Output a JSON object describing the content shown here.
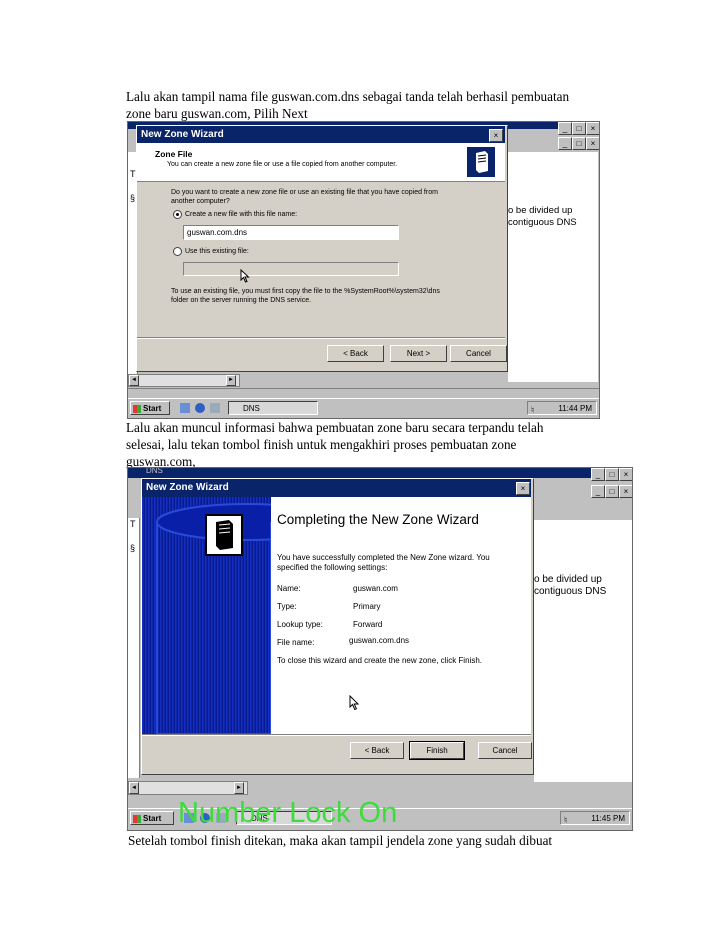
{
  "doc": {
    "p1_line1": "Lalu akan tampil nama file guswan.com.dns sebagai tanda telah berhasil pembuatan",
    "p1_line2": "zone baru guswan.com, Pilih Next",
    "p2_line1": "Lalu akan muncul informasi bahwa pembuatan zone baru secara terpandu telah",
    "p2_line2": "selesai, lalu tekan tombol finish untuk mengakhiri proses pembuatan zone",
    "p2_line3": "guswan.com,",
    "p3_line1": "Setelah tombol finish ditekan, maka akan tampil jendela zone yang sudah dibuat"
  },
  "shot1": {
    "wizard_title": "New Zone Wizard",
    "header_title": "Zone File",
    "header_subtitle": "You can create a new zone file or use a file copied from another computer.",
    "question_line1": "Do you want to create a new zone file or use an existing file that you have copied from",
    "question_line2": "another computer?",
    "option_create_label": "Create a new file with this file name:",
    "filename_value": "guswan.com.dns",
    "option_existing_label": "Use this existing file:",
    "existing_value": "",
    "note_line1": "To use an existing file, you must first copy the file to the %SystemRoot%\\system32\\dns",
    "note_line2": "folder on the server running the DNS service.",
    "back_label": "< Back",
    "next_label": "Next >",
    "cancel_label": "Cancel",
    "bg_text_line1": "o be divided up",
    "bg_text_line2": "contiguous DNS",
    "bg_sidebar_1": "T",
    "bg_sidebar_2": "§",
    "start_label": "Start",
    "task_label": "DNS",
    "clock": "11:44 PM",
    "win_min": "_",
    "win_max": "□",
    "win_close": "×",
    "close_glyph": "×",
    "scroll_left": "◄",
    "scroll_right": "►"
  },
  "shot2": {
    "window_title_bg": "DNS",
    "wizard_title": "New Zone Wizard",
    "heading": "Completing the New Zone Wizard",
    "intro_line1": "You have successfully completed the New Zone wizard. You",
    "intro_line2": "specified the following settings:",
    "settings": [
      {
        "label": "Name:",
        "value": "guswan.com"
      },
      {
        "label": "Type:",
        "value": "Primary"
      },
      {
        "label": "Lookup type:",
        "value": "Forward"
      },
      {
        "label": "File name:",
        "value": "guswan.com.dns"
      }
    ],
    "closing_text": "To close this wizard and create the new zone, click Finish.",
    "back_label": "< Back",
    "finish_label": "Finish",
    "cancel_label": "Cancel",
    "bg_text_line1": "o be divided up",
    "bg_text_line2": "contiguous DNS",
    "bg_sidebar_1": "T",
    "bg_sidebar_2": "§",
    "overlay_text": "Number Lock On",
    "start_label": "Start",
    "task_label": "DNS",
    "clock": "11:45 PM",
    "win_min": "_",
    "win_max": "□",
    "win_close": "×",
    "close_glyph": "×",
    "scroll_left": "◄",
    "scroll_right": "►"
  }
}
